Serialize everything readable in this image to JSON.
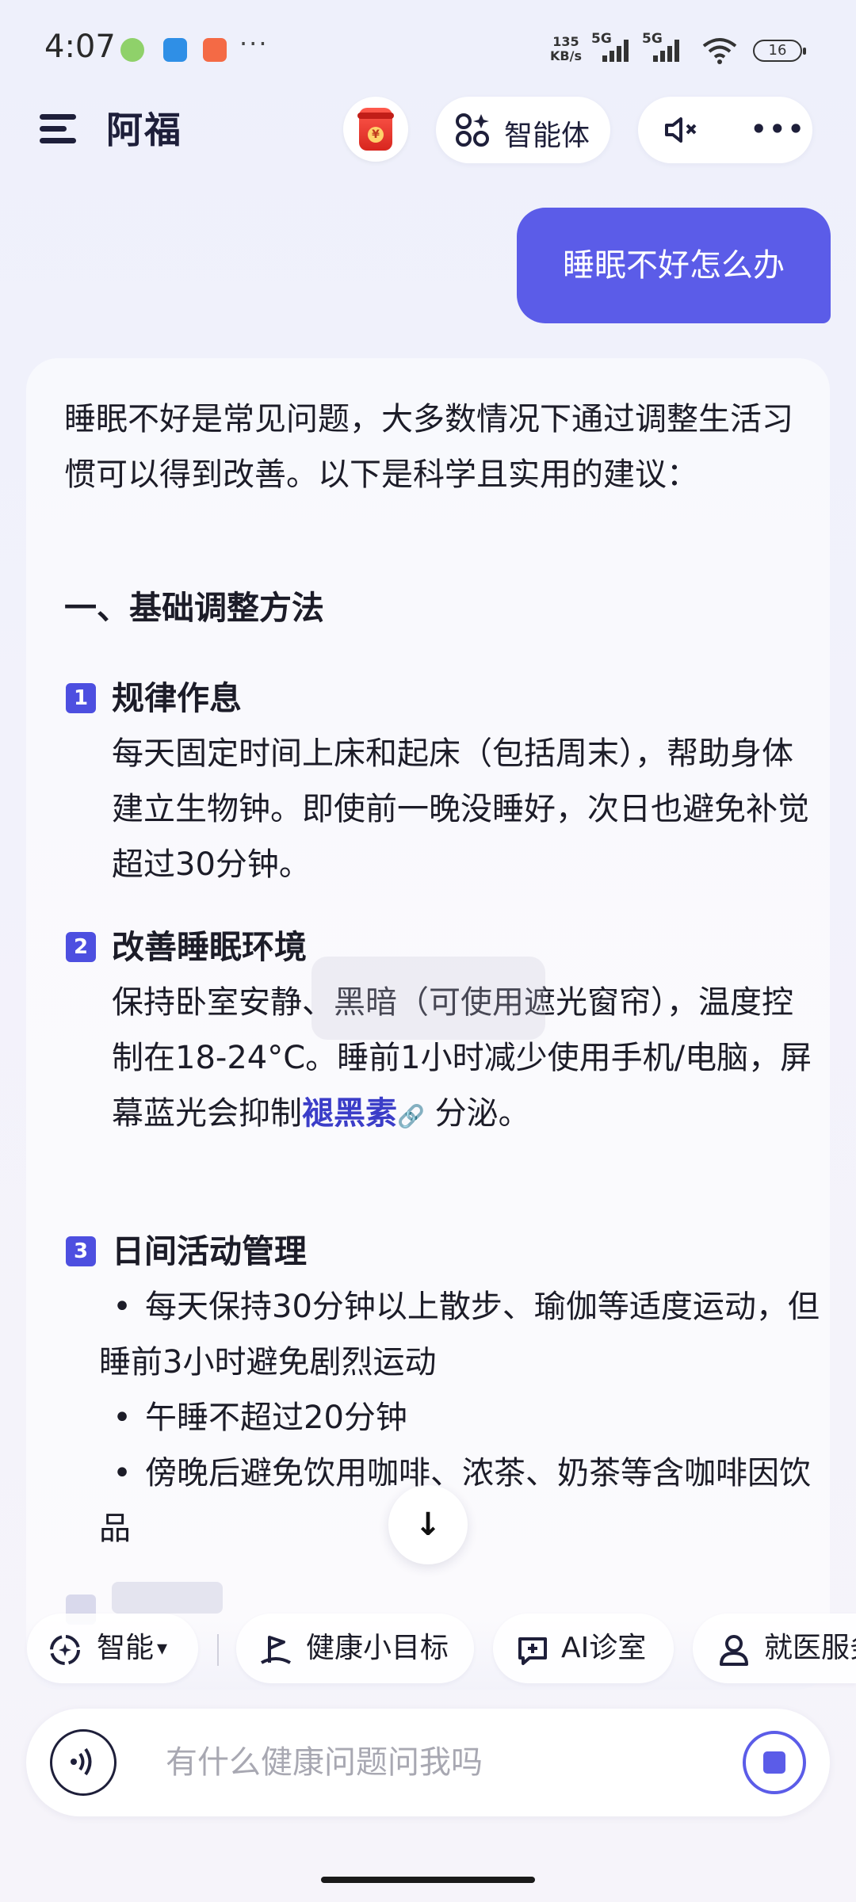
{
  "status_bar": {
    "time": "4:07",
    "more": "···",
    "net_speed_value": "135",
    "net_speed_unit": "KB/s",
    "signal_1": "5G",
    "signal_2": "5G",
    "battery": "16"
  },
  "header": {
    "title": "阿福",
    "agent_label": "智能体",
    "more": "•••"
  },
  "conversation": {
    "user_message": "睡眠不好怎么办",
    "answer": {
      "intro": "睡眠不好是常见问题，大多数情况下通过调整生活习惯可以得到改善。以下是科学且实用的建议：",
      "section_title": "一、基础调整方法",
      "items": [
        {
          "num": "1",
          "title": "规律作息",
          "body": "每天固定时间上床和起床（包括周末），帮助身体建立生物钟。即使前一晚没睡好，次日也避免补觉超过30分钟。"
        },
        {
          "num": "2",
          "title": "改善睡眠环境",
          "body_before": "保持卧室安静、黑暗（可使用遮光窗帘），温度控制在18-24°C。睡前1小时减少使用手机/电脑，屏幕蓝光会抑制",
          "link": "褪黑素",
          "link_icon": "🔗",
          "body_after": "分泌。"
        },
        {
          "num": "3",
          "title": "日间活动管理",
          "bullets": [
            "每天保持30分钟以上散步、瑜伽等适度运动，但睡前3小时避免剧烈运动",
            "午睡不超过20分钟",
            "傍晚后避免饮用咖啡、浓茶、奶茶等含咖啡因饮品"
          ]
        }
      ],
      "scroll_down": "↓"
    }
  },
  "quick_actions": [
    {
      "label": "智能",
      "icon": "smart-mode-icon",
      "caret": "▾"
    },
    {
      "label": "健康小目标",
      "icon": "goal-flag-icon"
    },
    {
      "label": "AI诊室",
      "icon": "chat-plus-icon"
    },
    {
      "label": "就医服务",
      "icon": "doctor-icon"
    }
  ],
  "input": {
    "placeholder": "有什么健康问题问我吗"
  },
  "colors": {
    "accent": "#5b5ce8",
    "badge": "#4d4fe0",
    "link": "#3b3dc8"
  }
}
